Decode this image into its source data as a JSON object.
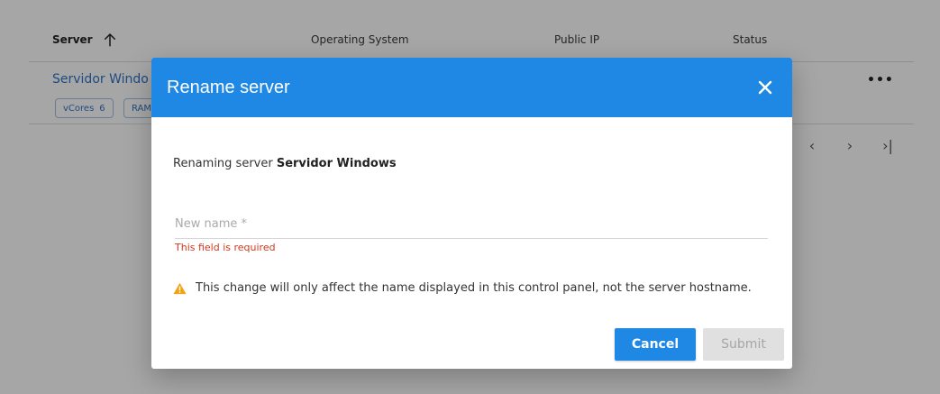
{
  "table": {
    "columns": {
      "server": "Server",
      "os": "Operating System",
      "public_ip": "Public IP",
      "status": "Status"
    },
    "row": {
      "server_name": "Servidor Windo",
      "chips": [
        {
          "label": "vCores",
          "value": "6"
        },
        {
          "label": "RAM",
          "value": ""
        }
      ],
      "menu": "•••"
    },
    "pager": {
      "prev": "‹",
      "next": "›",
      "last": "›|"
    }
  },
  "dialog": {
    "title": "Rename server",
    "renaming_prefix": "Renaming server",
    "server_name": "Servidor Windows",
    "field": {
      "placeholder": "New name *",
      "value": ""
    },
    "error": "This field is required",
    "warning": "This change will only affect the name displayed in this control panel, not the server hostname.",
    "buttons": {
      "cancel": "Cancel",
      "submit": "Submit"
    }
  },
  "colors": {
    "accent": "#1f88e5",
    "error": "#d13a1e",
    "warning": "#f2a20c",
    "link": "#2e73c8"
  },
  "icons": {
    "sort": "arrow-up-icon",
    "close": "close-icon",
    "warning": "warning-triangle-icon"
  }
}
